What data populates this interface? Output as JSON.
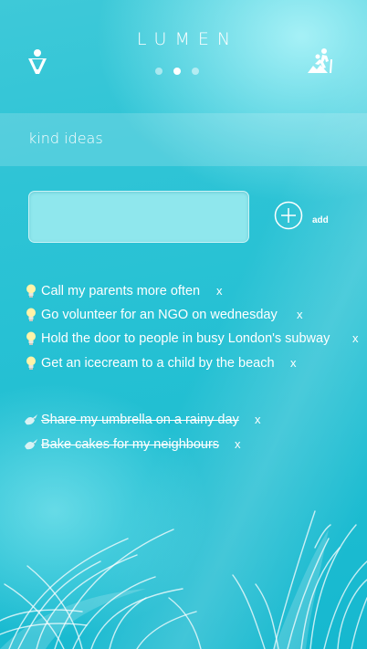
{
  "app": {
    "title": "LUMEN",
    "left_icon": "person-icon",
    "right_icon": "hiker-icon",
    "pager": {
      "count": 3,
      "active_index": 1
    }
  },
  "section": {
    "title": "kind ideas"
  },
  "input": {
    "value": "",
    "placeholder": ""
  },
  "add_button": {
    "label": "add",
    "icon": "plus-circle-icon"
  },
  "ideas": [
    {
      "text": "Call my parents more often",
      "icon": "lightbulb-icon",
      "remove_label": "x",
      "done": false
    },
    {
      "text": "Go volunteer for an NGO on wednesday",
      "icon": "lightbulb-icon",
      "remove_label": "x",
      "done": false
    },
    {
      "text": "Hold the door to people in busy London's subway",
      "icon": "lightbulb-icon",
      "remove_label": "x",
      "done": false
    },
    {
      "text": "Get an icecream to a child by the beach",
      "icon": "lightbulb-icon",
      "remove_label": "x",
      "done": false
    }
  ],
  "completed": [
    {
      "text": "Share my umbrella on a rainy day",
      "icon": "dove-icon",
      "remove_label": "x",
      "done": true
    },
    {
      "text": "Bake cakes for my neighbours",
      "icon": "dove-icon",
      "remove_label": "x",
      "done": true
    }
  ],
  "colors": {
    "background": "#24c0d3",
    "accent": "#ffffff",
    "input_fill": "#8fe7ed",
    "bulb": "#fff3a8"
  }
}
